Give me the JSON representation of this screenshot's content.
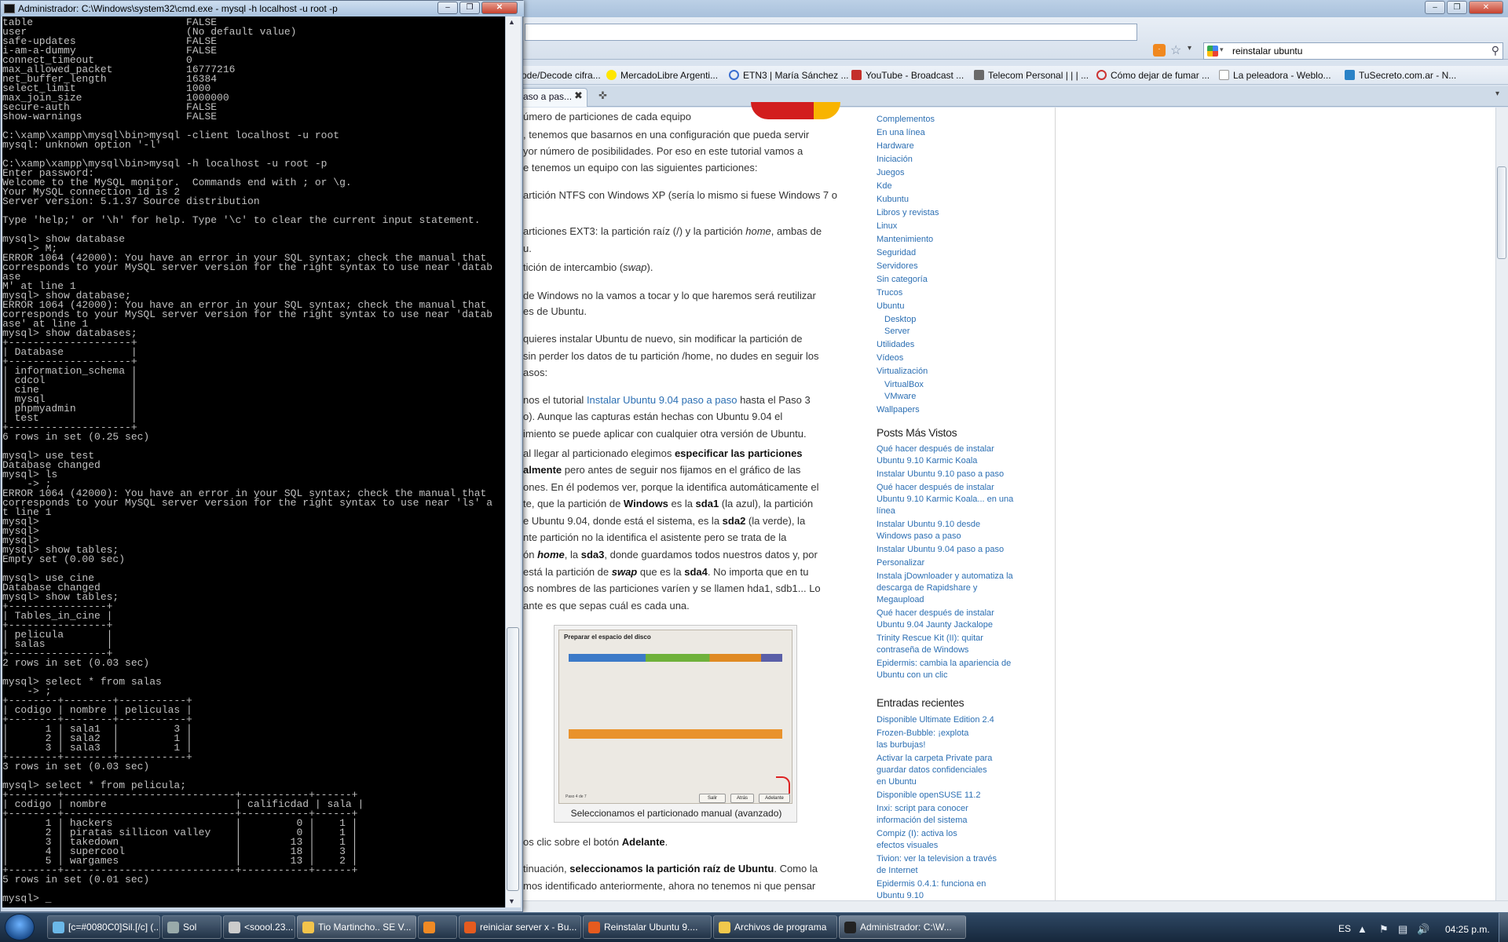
{
  "cmd": {
    "title": "Administrador: C:\\Windows\\system32\\cmd.exe - mysql  -h localhost -u root -p",
    "console_text": "table                         FALSE\nuser                          (No default value)\nsafe-updates                  FALSE\ni-am-a-dummy                  FALSE\nconnect_timeout               0\nmax_allowed_packet            16777216\nnet_buffer_length             16384\nselect_limit                  1000\nmax_join_size                 1000000\nsecure-auth                   FALSE\nshow-warnings                 FALSE\n\nC:\\xamp\\xampp\\mysql\\bin>mysql -client localhost -u root\nmysql: unknown option '-l'\n\nC:\\xamp\\xampp\\mysql\\bin>mysql -h localhost -u root -p\nEnter password:\nWelcome to the MySQL monitor.  Commands end with ; or \\g.\nYour MySQL connection id is 2\nServer version: 5.1.37 Source distribution\n\nType 'help;' or '\\h' for help. Type '\\c' to clear the current input statement.\n\nmysql> show database\n    -> M;\nERROR 1064 (42000): You have an error in your SQL syntax; check the manual that\ncorresponds to your MySQL server version for the right syntax to use near 'datab\nase\nM' at line 1\nmysql> show database;\nERROR 1064 (42000): You have an error in your SQL syntax; check the manual that\ncorresponds to your MySQL server version for the right syntax to use near 'datab\nase' at line 1\nmysql> show databases;\n+--------------------+\n| Database           |\n+--------------------+\n| information_schema |\n| cdcol              |\n| cine               |\n| mysql              |\n| phpmyadmin         |\n| test               |\n+--------------------+\n6 rows in set (0.25 sec)\n\nmysql> use test\nDatabase changed\nmysql> ls\n    -> ;\nERROR 1064 (42000): You have an error in your SQL syntax; check the manual that\ncorresponds to your MySQL server version for the right syntax to use near 'ls' a\nt line 1\nmysql>\nmysql>\nmysql>\nmysql> show tables;\nEmpty set (0.00 sec)\n\nmysql> use cine\nDatabase changed\nmysql> show tables;\n+----------------+\n| Tables_in_cine |\n+----------------+\n| pelicula       |\n| salas          |\n+----------------+\n2 rows in set (0.03 sec)\n\nmysql> select * from salas\n    -> ;\n+--------+--------+-----------+\n| codigo | nombre | peliculas |\n+--------+--------+-----------+\n|      1 | sala1  |         3 |\n|      2 | sala2  |         1 |\n|      3 | sala3  |         1 |\n+--------+--------+-----------+\n3 rows in set (0.03 sec)\n\nmysql> select * from pelicula;\n+--------+----------------------------+-----------+------+\n| codigo | nombre                     | calificdad | sala |\n+--------+----------------------------+-----------+------+\n|      1 | hackers                    |         0 |    1 |\n|      2 | piratas sillicon valley    |         0 |    1 |\n|      3 | takedown                   |        13 |    1 |\n|      4 | supercool                  |        18 |    3 |\n|      5 | wargames                   |        13 |    2 |\n+--------+----------------------------+-----------+------+\n5 rows in set (0.01 sec)\n\nmysql> _"
  },
  "browser": {
    "search_text": "reinstalar ubuntu",
    "bookmarks": [
      "ode/Decode cifra...",
      "MercadoLibre Argenti...",
      "ETN3 | María Sánchez ...",
      "YouTube - Broadcast ...",
      "Telecom Personal | | | ...",
      "Cómo dejar de fumar ...",
      "La peleadora - Weblo...",
      "TuSecreto.com.ar - N..."
    ],
    "tab_label": "aso a pas...",
    "article": {
      "l1": "úmero de particiones de cada equipo",
      "l2": ", tenemos que basarnos en una configuración que pueda servir",
      "l3": "yor número de posibilidades. Por eso en este tutorial vamos a",
      "l4": "e tenemos un equipo con las siguientes particiones:",
      "l5": "artición NTFS con Windows XP (sería lo mismo si fuese Windows 7 o",
      "l6a": "articiones EXT3: la partición raíz (/) y la partición ",
      "l6b": "home",
      "l6c": ", ambas de",
      "l7": "u.",
      "l8a": "tición de intercambio (",
      "l8b": "swap",
      "l8c": ").",
      "l9": " de Windows no la vamos a tocar y lo que haremos será reutilizar",
      "l10": "es de Ubuntu.",
      "l11": "quieres instalar Ubuntu de nuevo, sin modificar la partición de",
      "l12": "sin perder los datos de tu partición /home, no dudes en seguir los",
      "l13": "asos:",
      "l14a": "nos el tutorial ",
      "l14link": "Instalar Ubuntu 9.04 paso a paso",
      "l14b": " hasta el Paso 3",
      "l15": "o). Aunque las capturas están hechas con Ubuntu 9.04 el",
      "l16": "imiento se puede aplicar con cualquier otra versión de Ubuntu.",
      "l17a": " al llegar al particionado elegimos ",
      "l17b": "especificar las particiones",
      "l18a": "almente",
      "l18b": " pero antes de seguir nos fijamos en el gráfico de las",
      "l19": "ones. En él podemos ver, porque la identifica automáticamente el",
      "l20a": "te, que la partición de ",
      "l20b": "Windows",
      "l20c": " es la ",
      "l20d": "sda1",
      "l20e": " (la azul), la partición",
      "l21a": "e Ubuntu 9.04, donde está el sistema, es la ",
      "l21b": "sda2",
      "l21c": " (la verde), la",
      "l22": "nte partición no la identifica el asistente pero se trata de la",
      "l23a": "ón ",
      "l23b": "home",
      "l23c": ", la ",
      "l23d": "sda3",
      "l23e": ", donde guardamos todos nuestros datos y, por",
      "l24a": " está la partición de ",
      "l24b": "swap",
      "l24c": " que es la ",
      "l24d": "sda4",
      "l24e": ". No importa que en tu",
      "l25": "os nombres de las particiones varíen y se llamen hda1, sdb1... Lo",
      "l26": "ante es que sepas cuál es cada una.",
      "img_title": "Preparar el espacio del disco",
      "img_caption": "Seleccionamos el particionado manual (avanzado)",
      "img_btn1": "Salir",
      "img_btn2": "Atrás",
      "img_btn3": "Adelante",
      "img_step": "Paso 4 de 7",
      "l27a": "os clic sobre el botón ",
      "l27b": "Adelante",
      "l27c": ".",
      "l28a": "tinuación, ",
      "l28b": "seleccionamos la partición raíz de Ubuntu",
      "l28c": ". Como la",
      "l29": "mos identificado anteriormente, ahora no tenemos ni que pensar"
    },
    "sidebar": {
      "categories": [
        "Complementos",
        "En una línea",
        "Hardware",
        "Iniciación",
        "Juegos",
        "Kde",
        "Kubuntu",
        "Libros y revistas",
        "Linux",
        "Mantenimiento",
        "Seguridad",
        "Servidores",
        "Sin categoría",
        "Trucos",
        "Ubuntu",
        "Desktop",
        "Server",
        "Utilidades",
        "Vídeos",
        "Virtualización",
        "VirtualBox",
        "VMware",
        "Wallpapers"
      ],
      "posts_heading": "Posts Más Vistos",
      "posts": [
        [
          "Qué hacer después de instalar",
          "Ubuntu 9.10 Karmic Koala"
        ],
        [
          "Instalar Ubuntu 9.10 paso a paso"
        ],
        [
          "Qué hacer después de instalar",
          "Ubuntu 9.10 Karmic Koala... en una",
          "línea"
        ],
        [
          "Instalar Ubuntu 9.10 desde",
          "Windows paso a paso"
        ],
        [
          "Instalar Ubuntu 9.04 paso a paso"
        ],
        [
          "Personalizar"
        ],
        [
          "Instala jDownloader y automatiza la",
          "descarga de Rapidshare y",
          "Megaupload"
        ],
        [
          "Qué hacer después de instalar",
          "Ubuntu 9.04 Jaunty Jackalope"
        ],
        [
          "Trinity Rescue Kit (II): quitar",
          "contraseña de Windows"
        ],
        [
          "Epidermis: cambia la apariencia de",
          "Ubuntu con un clic"
        ]
      ],
      "recent_heading": "Entradas recientes",
      "recent": [
        [
          "Disponible Ultimate Edition 2.4"
        ],
        [
          "Frozen-Bubble: ¡explota",
          "las burbujas!"
        ],
        [
          "Activar la carpeta Private para",
          "guardar datos confidenciales",
          "en Ubuntu"
        ],
        [
          "Disponible openSUSE 11.2"
        ],
        [
          "Inxi: script para conocer",
          "información del sistema"
        ],
        [
          "Compiz (I): activa los",
          "efectos visuales"
        ],
        [
          "Tivion: ver la television a través",
          "de Internet"
        ],
        [
          "Epidermis 0.4.1: funciona en",
          "Ubuntu 9.10"
        ]
      ]
    }
  },
  "taskbar": {
    "items": [
      "[c=#0080C0]Sil.[/c] (...",
      "Sol",
      "<soool.23...",
      "Tio Martincho.. SE V...",
      "",
      "reiniciar server x - Bu...",
      "Reinstalar Ubuntu 9....",
      "Archivos de programa",
      "Administrador: C:\\W..."
    ],
    "lang": "ES",
    "clock": "04:25 p.m."
  }
}
